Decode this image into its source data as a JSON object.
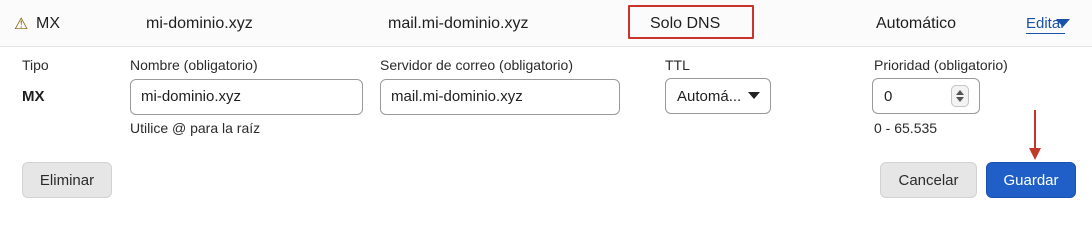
{
  "record_summary": {
    "warning_icon": "warning-triangle-icon",
    "type": "MX",
    "name": "mi-dominio.xyz",
    "content": "mail.mi-dominio.xyz",
    "proxy_status": "Solo DNS",
    "ttl": "Automático",
    "edit_label": "Editar"
  },
  "form": {
    "type_label": "Tipo",
    "type_value": "MX",
    "name_label": "Nombre (obligatorio)",
    "name_value": "mi-dominio.xyz",
    "name_hint": "Utilice @ para la raíz",
    "mail_server_label": "Servidor de correo (obligatorio)",
    "mail_server_value": "mail.mi-dominio.xyz",
    "ttl_label": "TTL",
    "ttl_value": "Automá...",
    "priority_label": "Prioridad (obligatorio)",
    "priority_value": "0",
    "priority_range": "0 - 65.535"
  },
  "actions": {
    "delete_label": "Eliminar",
    "cancel_label": "Cancelar",
    "save_label": "Guardar"
  },
  "colors": {
    "accent": "#1f5fc7",
    "highlight_box": "#c9342f",
    "annotation_arrow": "#c0392b",
    "link": "#1a52a8"
  }
}
